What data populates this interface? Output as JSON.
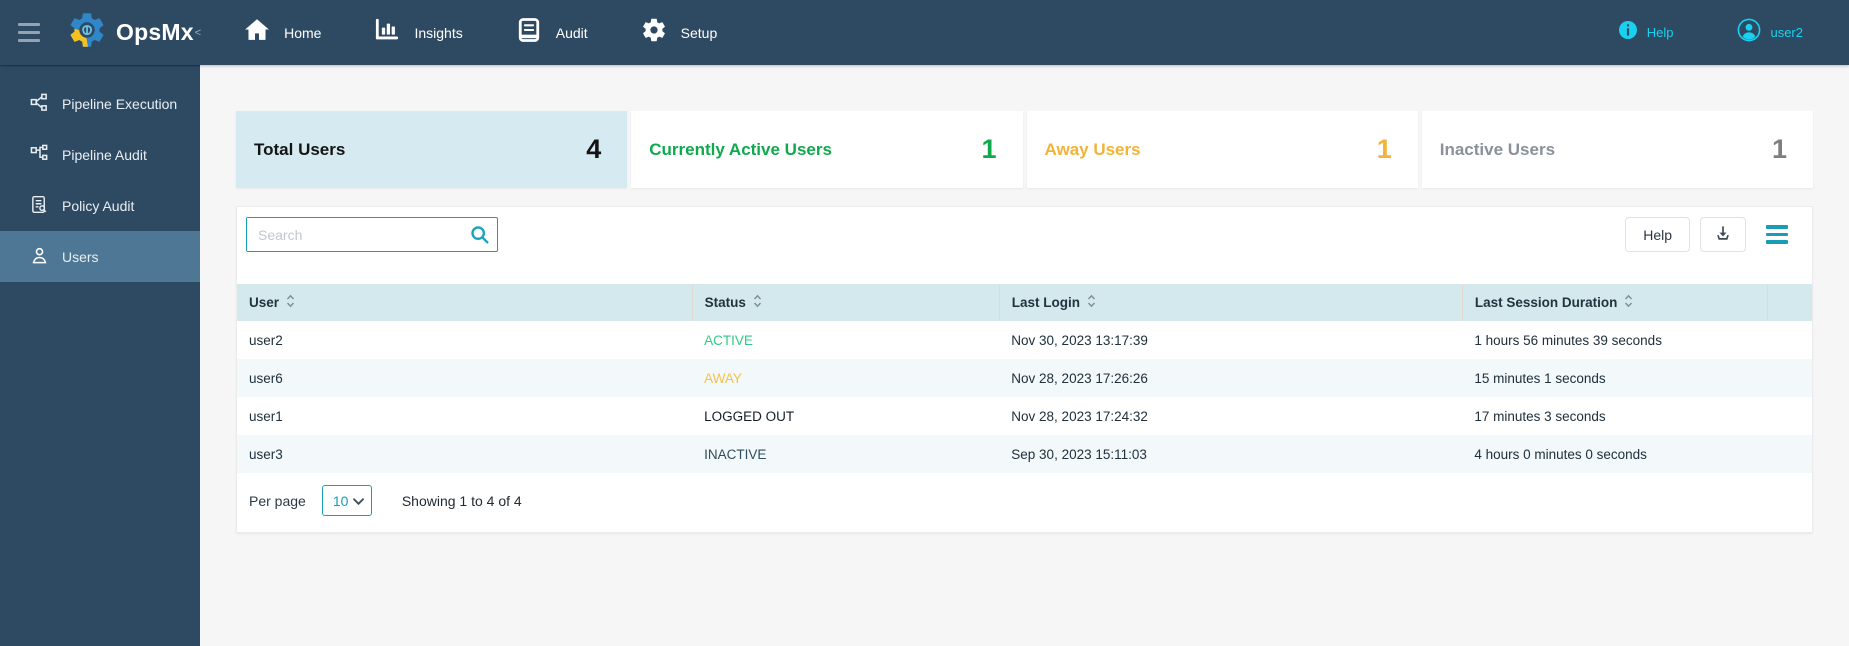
{
  "topbar": {
    "brand": "OpsMx",
    "brand_mark": "<",
    "nav": [
      {
        "label": "Home"
      },
      {
        "label": "Insights"
      },
      {
        "label": "Audit"
      },
      {
        "label": "Setup"
      }
    ],
    "help_label": "Help",
    "user_label": "user2"
  },
  "sidebar": {
    "items": [
      {
        "label": "Pipeline Execution"
      },
      {
        "label": "Pipeline Audit"
      },
      {
        "label": "Policy Audit"
      },
      {
        "label": "Users"
      }
    ],
    "active_item": "Users"
  },
  "cards": [
    {
      "label": "Total Users",
      "value": "4"
    },
    {
      "label": "Currently Active Users",
      "value": "1"
    },
    {
      "label": "Away Users",
      "value": "1"
    },
    {
      "label": "Inactive Users",
      "value": "1"
    }
  ],
  "toolbar": {
    "search_placeholder": "Search",
    "help_button_label": "Help"
  },
  "table": {
    "columns": [
      "User",
      "Status",
      "Last Login",
      "Last Session Duration"
    ],
    "rows": [
      {
        "user": "user2",
        "status": "ACTIVE",
        "last_login": "Nov 30, 2023 13:17:39",
        "duration": "1 hours 56 minutes 39 seconds"
      },
      {
        "user": "user6",
        "status": "AWAY",
        "last_login": "Nov 28, 2023 17:26:26",
        "duration": "15 minutes 1 seconds"
      },
      {
        "user": "user1",
        "status": "LOGGED OUT",
        "last_login": "Nov 28, 2023 17:24:32",
        "duration": "17 minutes 3 seconds"
      },
      {
        "user": "user3",
        "status": "INACTIVE",
        "last_login": "Sep 30, 2023 15:11:03",
        "duration": "4 hours 0 minutes 0 seconds"
      }
    ]
  },
  "pagination": {
    "per_page_label": "Per page",
    "per_page_value": "10",
    "showing_text": "Showing 1 to 4 of 4"
  },
  "colors": {
    "topbar_bg": "#2e4a62",
    "sidebar_active_bg": "#4d7795",
    "accent_cyan": "#18d1f0",
    "accent_teal": "#179db5",
    "card_highlight_bg": "#d6ebf1",
    "table_header_bg": "#d3e9ee",
    "status_active": "#2ecc87",
    "status_away": "#f5c04a",
    "status_logged_out": "#141e28",
    "status_inactive": "#2e4d5e",
    "card_green": "#0fa94e",
    "card_amber": "#f2b336",
    "card_gray": "#8a9199"
  }
}
